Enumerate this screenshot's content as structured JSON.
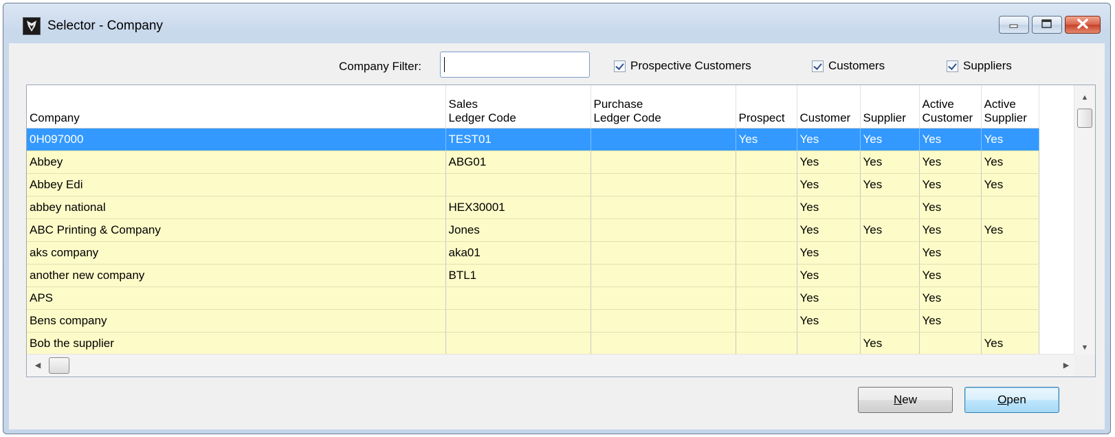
{
  "window": {
    "title": "Selector - Company"
  },
  "filter": {
    "label": "Company Filter:",
    "value": "",
    "checkboxes": [
      {
        "label": "Prospective Customers",
        "checked": true
      },
      {
        "label": "Customers",
        "checked": true
      },
      {
        "label": "Suppliers",
        "checked": true
      }
    ]
  },
  "grid": {
    "columns": [
      {
        "line1": "",
        "line2": "Company"
      },
      {
        "line1": "Sales",
        "line2": "Ledger Code"
      },
      {
        "line1": "Purchase",
        "line2": "Ledger Code"
      },
      {
        "line1": "",
        "line2": "Prospect"
      },
      {
        "line1": "",
        "line2": "Customer"
      },
      {
        "line1": "",
        "line2": "Supplier"
      },
      {
        "line1": "Active",
        "line2": "Customer"
      },
      {
        "line1": "Active",
        "line2": "Supplier"
      }
    ],
    "rows": [
      [
        "0H097000",
        "TEST01",
        "",
        "Yes",
        "Yes",
        "Yes",
        "Yes",
        "Yes"
      ],
      [
        "Abbey",
        "ABG01",
        "",
        "",
        "Yes",
        "Yes",
        "Yes",
        "Yes"
      ],
      [
        "Abbey Edi",
        "",
        "",
        "",
        "Yes",
        "Yes",
        "Yes",
        "Yes"
      ],
      [
        "abbey national",
        "HEX30001",
        "",
        "",
        "Yes",
        "",
        "Yes",
        ""
      ],
      [
        "ABC Printing & Company",
        "Jones",
        "",
        "",
        "Yes",
        "Yes",
        "Yes",
        "Yes"
      ],
      [
        "aks company",
        "aka01",
        "",
        "",
        "Yes",
        "",
        "Yes",
        ""
      ],
      [
        "another new company",
        "BTL1",
        "",
        "",
        "Yes",
        "",
        "Yes",
        ""
      ],
      [
        "APS",
        "",
        "",
        "",
        "Yes",
        "",
        "Yes",
        ""
      ],
      [
        "Bens company",
        "",
        "",
        "",
        "Yes",
        "",
        "Yes",
        ""
      ],
      [
        "Bob the supplier",
        "",
        "",
        "",
        "",
        "Yes",
        "",
        "Yes"
      ]
    ],
    "selected_row": 0
  },
  "buttons": {
    "new_label": "New",
    "new_mnemonic": "N",
    "new_rest": "ew",
    "open_label": "Open",
    "open_mnemonic": "O",
    "open_rest": "pen"
  },
  "icons": {
    "app": "app-logo-icon",
    "minimize": "minimize-icon",
    "maximize": "maximize-icon",
    "close": "close-icon"
  },
  "colors": {
    "row_background": "#fdfbc8",
    "selected_row": "#3399ff"
  }
}
